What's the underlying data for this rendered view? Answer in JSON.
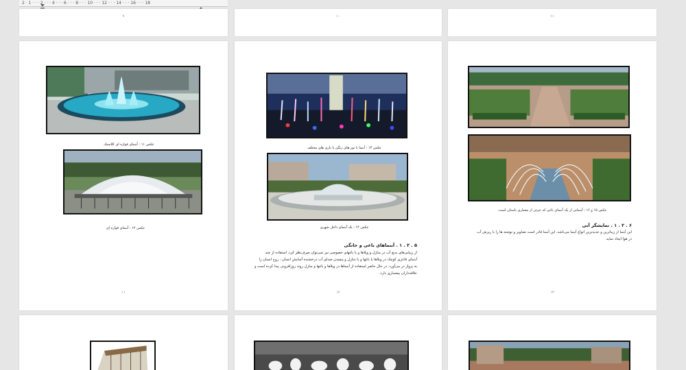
{
  "ruler": {
    "numbers": "2 · 1 · · · 2 · · · 4 · · · 6 · · · 8 · · · 10 · · · 12 · · · 14 · · · 16 · · · 18"
  },
  "top_row": {
    "left_page_number": "۹",
    "middle_page_number": "۱۰",
    "right_page_number": "۱۱"
  },
  "left_page": {
    "caption_1": "عکس ۱۱ : آبنمای فواره ای کلاسیک",
    "caption_2": "عکس ۱۲ : آبنمای فواره ای",
    "page_number": "۱۱"
  },
  "middle_page": {
    "caption_1": "عکس ۱۳ : آبنما با نور های رنگی با بازی های مختلف",
    "caption_2": "عکس ۱۴ : یک آبنمای داخل شهری",
    "heading": "۵ . ۲ . ۱ . آبنماهای باغی و خانگی",
    "body_lines": [
      "از زیبایی‌های بدیع آب در منازل و ویلاها و یا باغهای خصوصی نیز نمی‌توان صرف‌نظر کرد. استفاده از چند",
      "آبنمای فانتزی کوچک در ویلاها یا باغها و یا منازل و پیچیدن صدای آب درخشنده آسایش انسان ، روح انسان را",
      "به پرواز در می‌آورد. در حال حاضر استفاده از آبنماها در ویلاها و باغها و منازل روند روزافزونی پیدا کرده است و",
      "علاقه‌داران بیشماری دارد."
    ],
    "page_number": "۱۲"
  },
  "right_page": {
    "caption_1": "عکس ۱۵ و ۱۶ : آبنمایی از یک آبنمای باغی که جزئی از معماری باستان است.",
    "heading": "۶ . ۲ . ۱ . نمایشگر آبی",
    "body_lines": [
      "این آبنما از زیباترین و جدیدترین انواع آبنما می‌باشد. این آبنما قادر است تصاویر و نوشته ها را با ریزش آب",
      "در هوا ایجاد نماید."
    ],
    "page_number": "۱۳"
  },
  "colors": {
    "background": "#e6e6e6",
    "page": "#ffffff",
    "frame": "#111111"
  }
}
